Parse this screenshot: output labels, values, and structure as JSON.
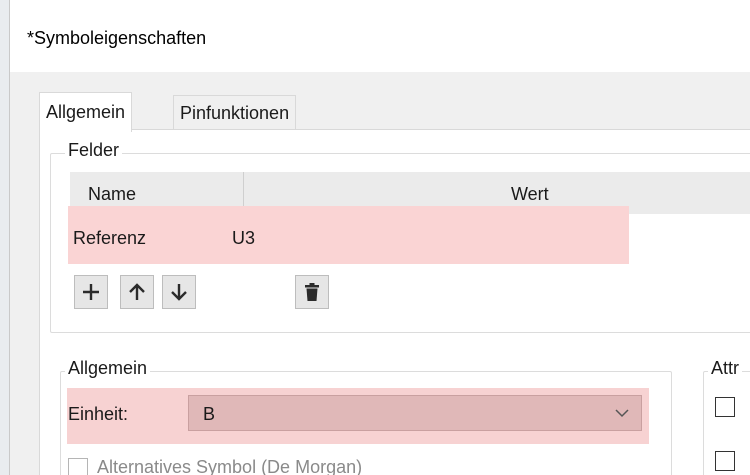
{
  "window": {
    "title": "*Symboleigenschaften"
  },
  "tabs": [
    {
      "label": "Allgemein",
      "active": true
    },
    {
      "label": "Pinfunktionen",
      "active": false
    }
  ],
  "fields_group": {
    "label": "Felder",
    "columns": [
      "Name",
      "Wert"
    ],
    "rows": [
      {
        "name": "Referenz",
        "value": "U3",
        "highlighted": true
      }
    ],
    "toolbar": [
      {
        "icon": "plus-icon",
        "action": "add"
      },
      {
        "icon": "arrow-up-icon",
        "action": "move-up"
      },
      {
        "icon": "arrow-down-icon",
        "action": "move-down"
      },
      {
        "icon": "trash-icon",
        "action": "delete"
      }
    ]
  },
  "general_group": {
    "label": "Allgemein",
    "unit_label": "Einheit:",
    "unit_value": "B",
    "alt_symbol_label": "Alternatives Symbol (De Morgan)"
  },
  "attributes_group": {
    "label": "Attr"
  },
  "colors": {
    "highlight": "#fad4d4",
    "select_highlight": "#e0b8b8"
  }
}
